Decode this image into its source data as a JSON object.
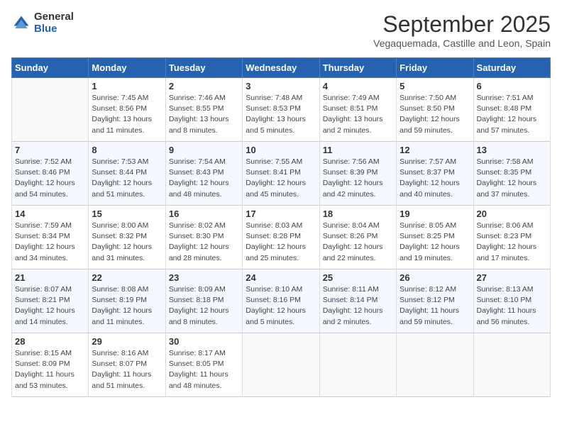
{
  "logo": {
    "general": "General",
    "blue": "Blue"
  },
  "title": "September 2025",
  "subtitle": "Vegaquemada, Castille and Leon, Spain",
  "days_header": [
    "Sunday",
    "Monday",
    "Tuesday",
    "Wednesday",
    "Thursday",
    "Friday",
    "Saturday"
  ],
  "weeks": [
    [
      {
        "day": "",
        "info": ""
      },
      {
        "day": "1",
        "info": "Sunrise: 7:45 AM\nSunset: 8:56 PM\nDaylight: 13 hours\nand 11 minutes."
      },
      {
        "day": "2",
        "info": "Sunrise: 7:46 AM\nSunset: 8:55 PM\nDaylight: 13 hours\nand 8 minutes."
      },
      {
        "day": "3",
        "info": "Sunrise: 7:48 AM\nSunset: 8:53 PM\nDaylight: 13 hours\nand 5 minutes."
      },
      {
        "day": "4",
        "info": "Sunrise: 7:49 AM\nSunset: 8:51 PM\nDaylight: 13 hours\nand 2 minutes."
      },
      {
        "day": "5",
        "info": "Sunrise: 7:50 AM\nSunset: 8:50 PM\nDaylight: 12 hours\nand 59 minutes."
      },
      {
        "day": "6",
        "info": "Sunrise: 7:51 AM\nSunset: 8:48 PM\nDaylight: 12 hours\nand 57 minutes."
      }
    ],
    [
      {
        "day": "7",
        "info": "Sunrise: 7:52 AM\nSunset: 8:46 PM\nDaylight: 12 hours\nand 54 minutes."
      },
      {
        "day": "8",
        "info": "Sunrise: 7:53 AM\nSunset: 8:44 PM\nDaylight: 12 hours\nand 51 minutes."
      },
      {
        "day": "9",
        "info": "Sunrise: 7:54 AM\nSunset: 8:43 PM\nDaylight: 12 hours\nand 48 minutes."
      },
      {
        "day": "10",
        "info": "Sunrise: 7:55 AM\nSunset: 8:41 PM\nDaylight: 12 hours\nand 45 minutes."
      },
      {
        "day": "11",
        "info": "Sunrise: 7:56 AM\nSunset: 8:39 PM\nDaylight: 12 hours\nand 42 minutes."
      },
      {
        "day": "12",
        "info": "Sunrise: 7:57 AM\nSunset: 8:37 PM\nDaylight: 12 hours\nand 40 minutes."
      },
      {
        "day": "13",
        "info": "Sunrise: 7:58 AM\nSunset: 8:35 PM\nDaylight: 12 hours\nand 37 minutes."
      }
    ],
    [
      {
        "day": "14",
        "info": "Sunrise: 7:59 AM\nSunset: 8:34 PM\nDaylight: 12 hours\nand 34 minutes."
      },
      {
        "day": "15",
        "info": "Sunrise: 8:00 AM\nSunset: 8:32 PM\nDaylight: 12 hours\nand 31 minutes."
      },
      {
        "day": "16",
        "info": "Sunrise: 8:02 AM\nSunset: 8:30 PM\nDaylight: 12 hours\nand 28 minutes."
      },
      {
        "day": "17",
        "info": "Sunrise: 8:03 AM\nSunset: 8:28 PM\nDaylight: 12 hours\nand 25 minutes."
      },
      {
        "day": "18",
        "info": "Sunrise: 8:04 AM\nSunset: 8:26 PM\nDaylight: 12 hours\nand 22 minutes."
      },
      {
        "day": "19",
        "info": "Sunrise: 8:05 AM\nSunset: 8:25 PM\nDaylight: 12 hours\nand 19 minutes."
      },
      {
        "day": "20",
        "info": "Sunrise: 8:06 AM\nSunset: 8:23 PM\nDaylight: 12 hours\nand 17 minutes."
      }
    ],
    [
      {
        "day": "21",
        "info": "Sunrise: 8:07 AM\nSunset: 8:21 PM\nDaylight: 12 hours\nand 14 minutes."
      },
      {
        "day": "22",
        "info": "Sunrise: 8:08 AM\nSunset: 8:19 PM\nDaylight: 12 hours\nand 11 minutes."
      },
      {
        "day": "23",
        "info": "Sunrise: 8:09 AM\nSunset: 8:18 PM\nDaylight: 12 hours\nand 8 minutes."
      },
      {
        "day": "24",
        "info": "Sunrise: 8:10 AM\nSunset: 8:16 PM\nDaylight: 12 hours\nand 5 minutes."
      },
      {
        "day": "25",
        "info": "Sunrise: 8:11 AM\nSunset: 8:14 PM\nDaylight: 12 hours\nand 2 minutes."
      },
      {
        "day": "26",
        "info": "Sunrise: 8:12 AM\nSunset: 8:12 PM\nDaylight: 11 hours\nand 59 minutes."
      },
      {
        "day": "27",
        "info": "Sunrise: 8:13 AM\nSunset: 8:10 PM\nDaylight: 11 hours\nand 56 minutes."
      }
    ],
    [
      {
        "day": "28",
        "info": "Sunrise: 8:15 AM\nSunset: 8:09 PM\nDaylight: 11 hours\nand 53 minutes."
      },
      {
        "day": "29",
        "info": "Sunrise: 8:16 AM\nSunset: 8:07 PM\nDaylight: 11 hours\nand 51 minutes."
      },
      {
        "day": "30",
        "info": "Sunrise: 8:17 AM\nSunset: 8:05 PM\nDaylight: 11 hours\nand 48 minutes."
      },
      {
        "day": "",
        "info": ""
      },
      {
        "day": "",
        "info": ""
      },
      {
        "day": "",
        "info": ""
      },
      {
        "day": "",
        "info": ""
      }
    ]
  ]
}
